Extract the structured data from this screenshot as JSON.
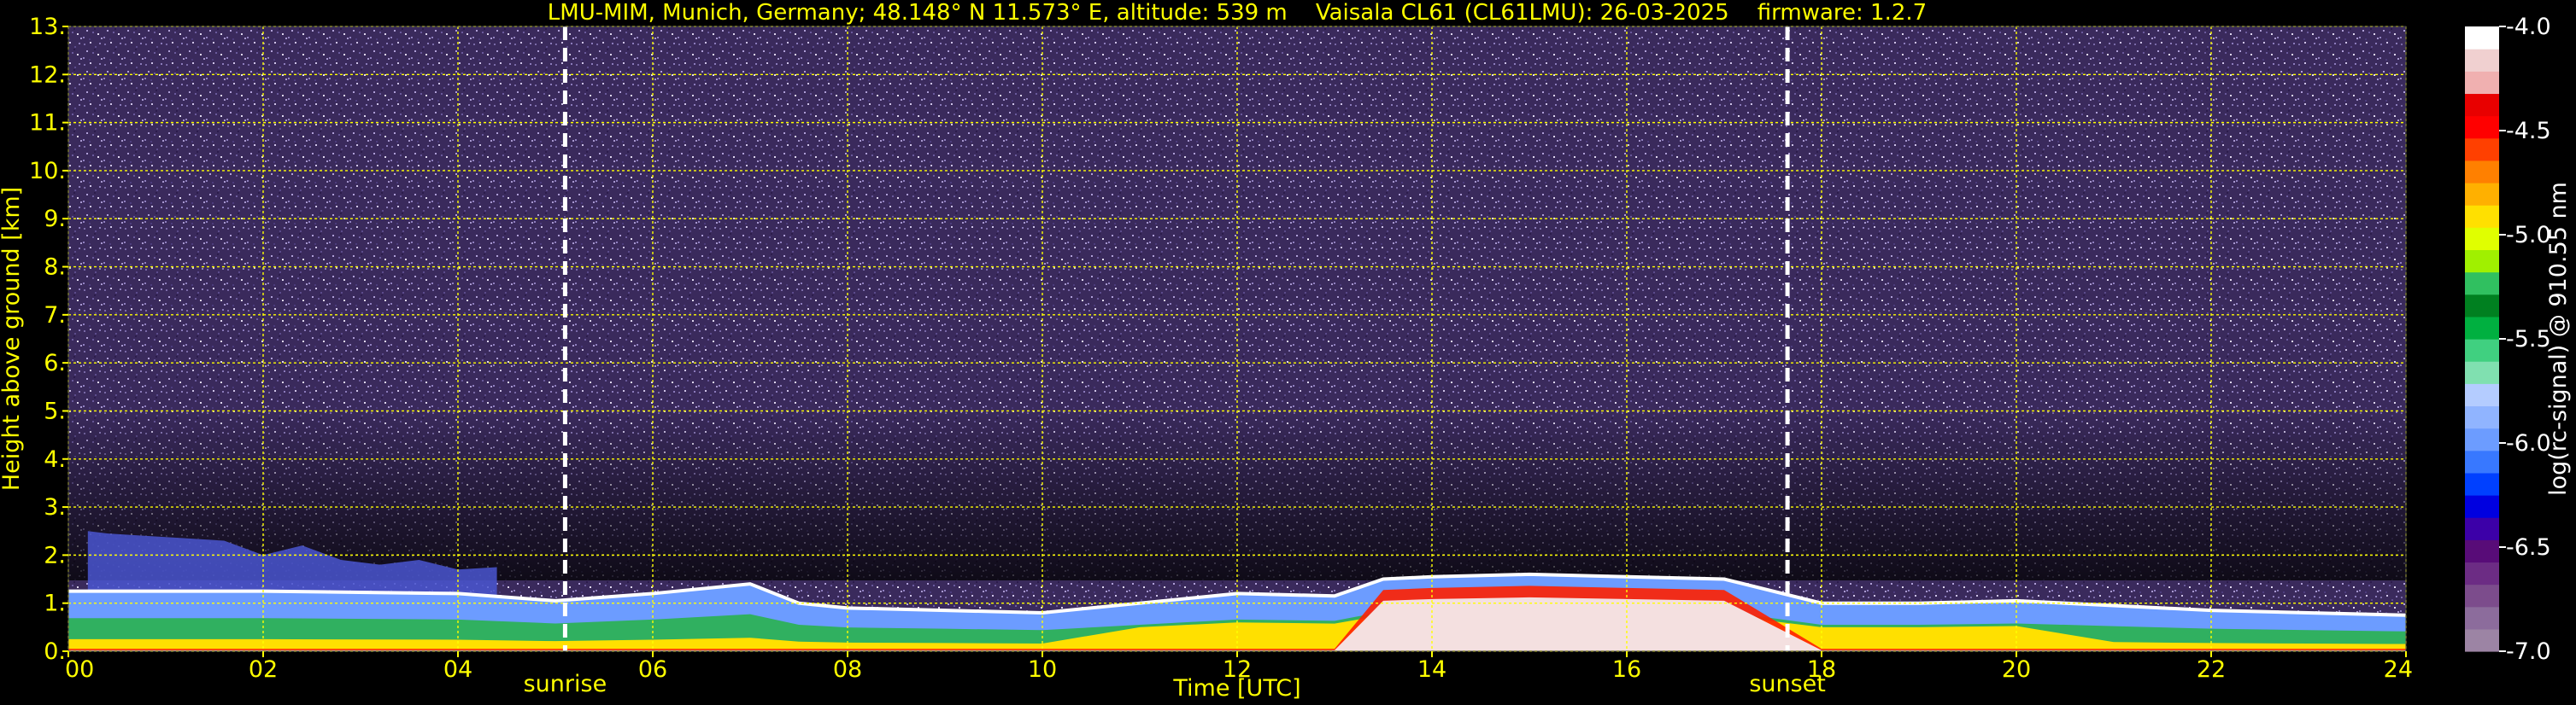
{
  "chart_data": {
    "type": "heatmap",
    "title": "LMU-MIM, Munich, Germany; 48.148° N 11.573° E, altitude: 539 m    Vaisala CL61 (CL61LMU): 26-03-2025    firmware: 1.2.7",
    "xlabel": "Time [UTC]",
    "ylabel": "Height above ground [km]",
    "xlim": [
      0,
      24
    ],
    "ylim": [
      0,
      13
    ],
    "x_ticks": [
      "00",
      "02",
      "04",
      "06",
      "08",
      "10",
      "12",
      "14",
      "16",
      "18",
      "20",
      "22",
      "24"
    ],
    "y_ticks": [
      "0.",
      "1.",
      "2.",
      "3.",
      "4.",
      "5.",
      "6.",
      "7.",
      "8.",
      "9.",
      "10.",
      "11.",
      "12.",
      "13."
    ],
    "grid": true,
    "colorbar": {
      "label": "log(rc-signal) @ 910.55 nm",
      "range": [
        -7.0,
        -4.0
      ],
      "ticks": [
        "-4.0",
        "-4.5",
        "-5.0",
        "-5.5",
        "-6.0",
        "-6.5",
        "-7.0"
      ],
      "colors": [
        "#9c84a4",
        "#8c6c9c",
        "#7c4c8c",
        "#6c2c84",
        "#580c78",
        "#3c00a8",
        "#0000e0",
        "#0040ff",
        "#3878ff",
        "#6c9cff",
        "#90b4ff",
        "#b4ccff",
        "#80e0b0",
        "#40d080",
        "#00b040",
        "#008020",
        "#30c060",
        "#a0f000",
        "#e0ff00",
        "#ffe000",
        "#ffb000",
        "#ff8000",
        "#ff4000",
        "#ff0000",
        "#e80000",
        "#f0b0b0",
        "#f0d0d0",
        "#ffffff"
      ]
    },
    "events": [
      {
        "label": "sunrise",
        "time": 5.1
      },
      {
        "label": "sunset",
        "time": 17.65
      }
    ],
    "layers": [
      {
        "kind": "boundary_layer_base",
        "time": [
          0,
          2,
          4,
          5,
          6,
          7,
          7.5,
          8,
          9,
          10,
          11,
          12,
          13,
          13.5,
          14,
          15,
          16,
          17,
          18,
          19,
          20,
          21,
          22,
          23,
          24
        ],
        "top_km": [
          1.25,
          1.25,
          1.2,
          1.05,
          1.2,
          1.4,
          1.0,
          0.9,
          0.85,
          0.8,
          1.0,
          1.2,
          1.15,
          1.5,
          1.55,
          1.6,
          1.55,
          1.5,
          1.0,
          1.0,
          1.05,
          0.95,
          0.85,
          0.8,
          0.75
        ]
      },
      {
        "kind": "residual_layer",
        "time": [
          0.2,
          0.4,
          0.8,
          1.2,
          1.6,
          2.0,
          2.4,
          2.8,
          3.2,
          3.6,
          4.0,
          4.4
        ],
        "top_km": [
          2.5,
          2.45,
          2.4,
          2.35,
          2.3,
          2.0,
          2.2,
          1.9,
          1.8,
          1.9,
          1.7,
          1.75
        ]
      }
    ]
  }
}
